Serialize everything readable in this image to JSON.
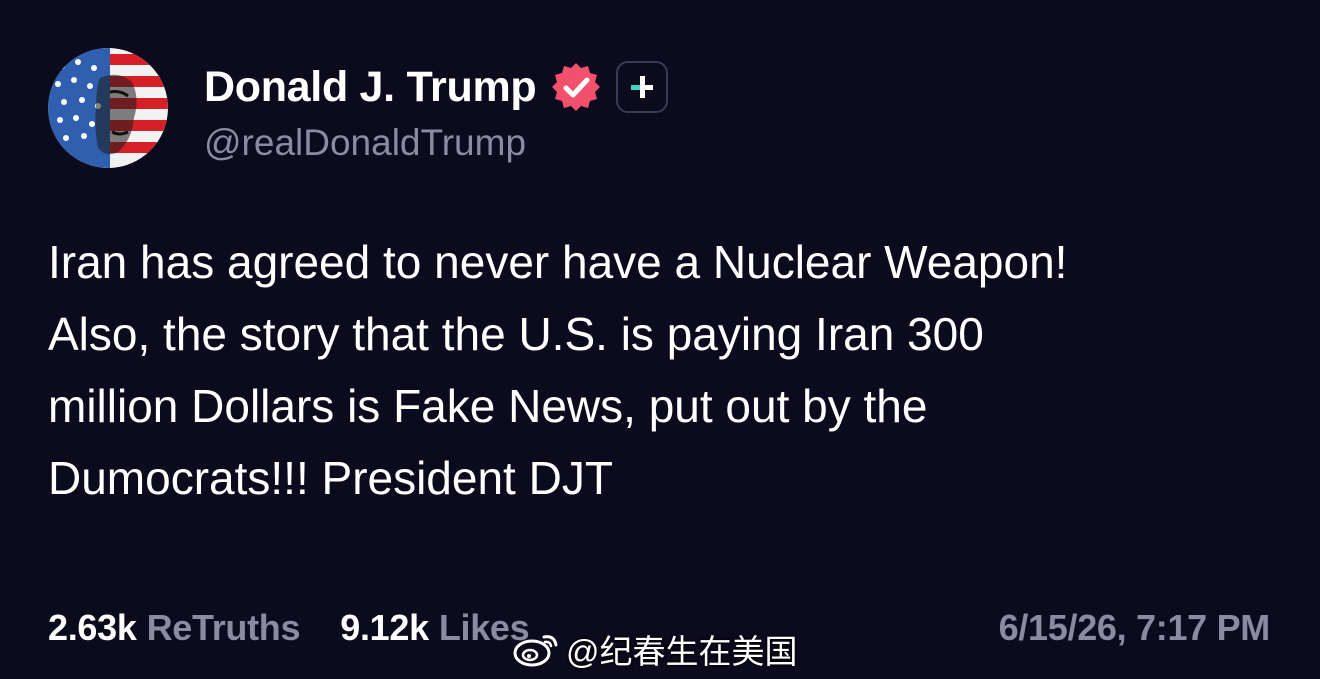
{
  "author": {
    "display_name": "Donald J. Trump",
    "handle": "@realDonaldTrump",
    "verified": true,
    "badges": [
      "verified-icon",
      "plus-icon"
    ],
    "avatar": "flag-portrait-avatar"
  },
  "post": {
    "lines": [
      "Iran has agreed to never have a Nuclear Weapon!",
      "Also, the story that the U.S. is paying Iran 300",
      "million Dollars is Fake News, put out by the",
      "Dumocrats!!! President DJT"
    ]
  },
  "stats": {
    "retruths_count": "2.63k",
    "retruths_label": "ReTruths",
    "likes_count": "9.12k",
    "likes_label": "Likes"
  },
  "timestamp": "6/15/26, 7:17 PM",
  "watermark": {
    "icon": "weibo-icon",
    "text": "@纪春生在美国"
  },
  "colors": {
    "background": "#0c0a1d",
    "primary_text": "#ffffff",
    "secondary_text": "#8c8aa0",
    "verified_badge": "#f2516e",
    "plus_accent": "#3fd6c0"
  }
}
